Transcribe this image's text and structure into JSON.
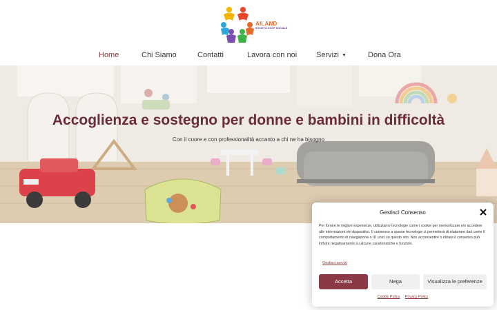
{
  "header": {
    "logo": {
      "name": "AILAND",
      "tagline": "SOCIETÀ COOP SOCIALE"
    },
    "nav": [
      {
        "label": "Home",
        "active": true
      },
      {
        "label": "Chi Siamo"
      },
      {
        "label": "Contatti"
      },
      {
        "label": "Lavora con noi"
      },
      {
        "label": "Servizi",
        "has_dropdown": true
      },
      {
        "label": "Dona Ora"
      }
    ]
  },
  "hero": {
    "title": "Accoglienza e sostegno per donne e bambini in difficoltà",
    "subtitle": "Con il cuore e con professionalità accanto a chi ne ha bisogno"
  },
  "consent": {
    "title": "Gestisci Consenso",
    "body": "Per fornire le migliori esperienze, utilizziamo tecnologie come i cookie per memorizzare e/o accedere alle informazioni del dispositivo. Il consenso a queste tecnologie ci permetterà di elaborare dati come il comportamento di navigazione o ID unici su questo sito. Non acconsentire o ritirare il consenso può influire negativamente su alcune caratteristiche e funzioni.",
    "manage_services": "Gestisci servizi",
    "accept": "Accetta",
    "deny": "Nega",
    "preferences": "Visualizza le preferenze",
    "cookie_policy": "Cookie Policy",
    "privacy_policy": "Privacy Policy"
  },
  "colors": {
    "accent": "#8b3a45",
    "title": "#6a2c3b",
    "active_nav": "#8a3a3a"
  }
}
